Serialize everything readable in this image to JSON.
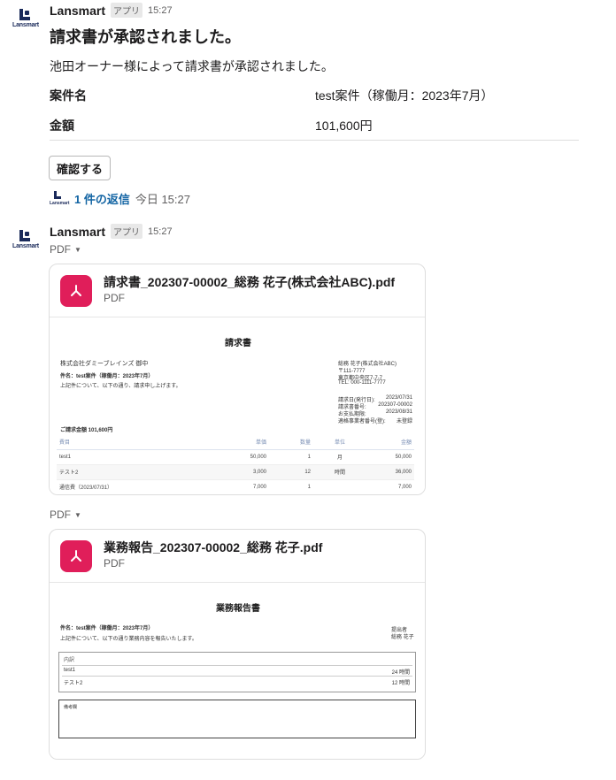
{
  "message1": {
    "sender": "Lansmart",
    "badge": "アプリ",
    "time": "15:27",
    "title": "請求書が承認されました。",
    "body": "池田オーナー様によって請求書が承認されました。",
    "fields": [
      {
        "label": "案件名",
        "value": "test案件（稼働月：2023年7月）"
      },
      {
        "label": "金額",
        "value": "101,600円"
      }
    ],
    "button_label": "確認する",
    "thread_replies": "1 件の返信",
    "thread_time": "今日 15:27"
  },
  "avatar_word": "Lansmart",
  "message2": {
    "sender": "Lansmart",
    "badge": "アプリ",
    "time": "15:27"
  },
  "pdf_toggle_label": "PDF",
  "files": [
    {
      "name": "請求書_202307-00002_総務 花子(株式会社ABC).pdf",
      "type": "PDF"
    },
    {
      "name": "業務報告_202307-00002_総務 花子.pdf",
      "type": "PDF"
    }
  ],
  "invoice": {
    "title": "請求書",
    "to": "株式会社ダミーブレインズ 御中",
    "subject": "件名：test案件（稼働月：2023年7月）",
    "note": "上記件について、以下の通り、請求申し上げます。",
    "sender_lines": [
      "総務 花子(株式会社ABC)",
      "〒111-7777",
      "東京都中央区7-7-7",
      "TEL: 000-1111-7777"
    ],
    "meta": [
      {
        "k": "請求日(発行日):",
        "v": "2023/07/31"
      },
      {
        "k": "請求書番号:",
        "v": "202307-00002"
      },
      {
        "k": "お支払期限:",
        "v": "2023/08/31"
      },
      {
        "k": "適格事業者番号(登):",
        "v": "未登録"
      }
    ],
    "total_line": "ご請求金額 101,600円",
    "headers": [
      "費目",
      "単価",
      "数量",
      "単位",
      "金額"
    ],
    "rows": [
      [
        "test1",
        "50,000",
        "1",
        "月",
        "50,000"
      ],
      [
        "テスト2",
        "3,000",
        "12",
        "時間",
        "36,000"
      ],
      [
        "通信費（2023/07/31）",
        "7,000",
        "1",
        "",
        "7,000"
      ]
    ]
  },
  "report": {
    "title": "業務報告書",
    "subject": "件名：test案件（稼働月：2023年7月）",
    "note": "上記件について、以下の通り業務内容を報告いたします。",
    "sender_lines": [
      "提出者",
      "総務 花子"
    ],
    "section": "内訳",
    "items": [
      {
        "name": "test1",
        "hours": "24 時間"
      },
      {
        "name": "テスト2",
        "hours": "12 時間"
      }
    ],
    "remarks": "備考欄"
  },
  "colors": {
    "accent_link": "#1264a3",
    "pdf_icon": "#e01e5a",
    "brand_navy": "#1a2a5a"
  }
}
